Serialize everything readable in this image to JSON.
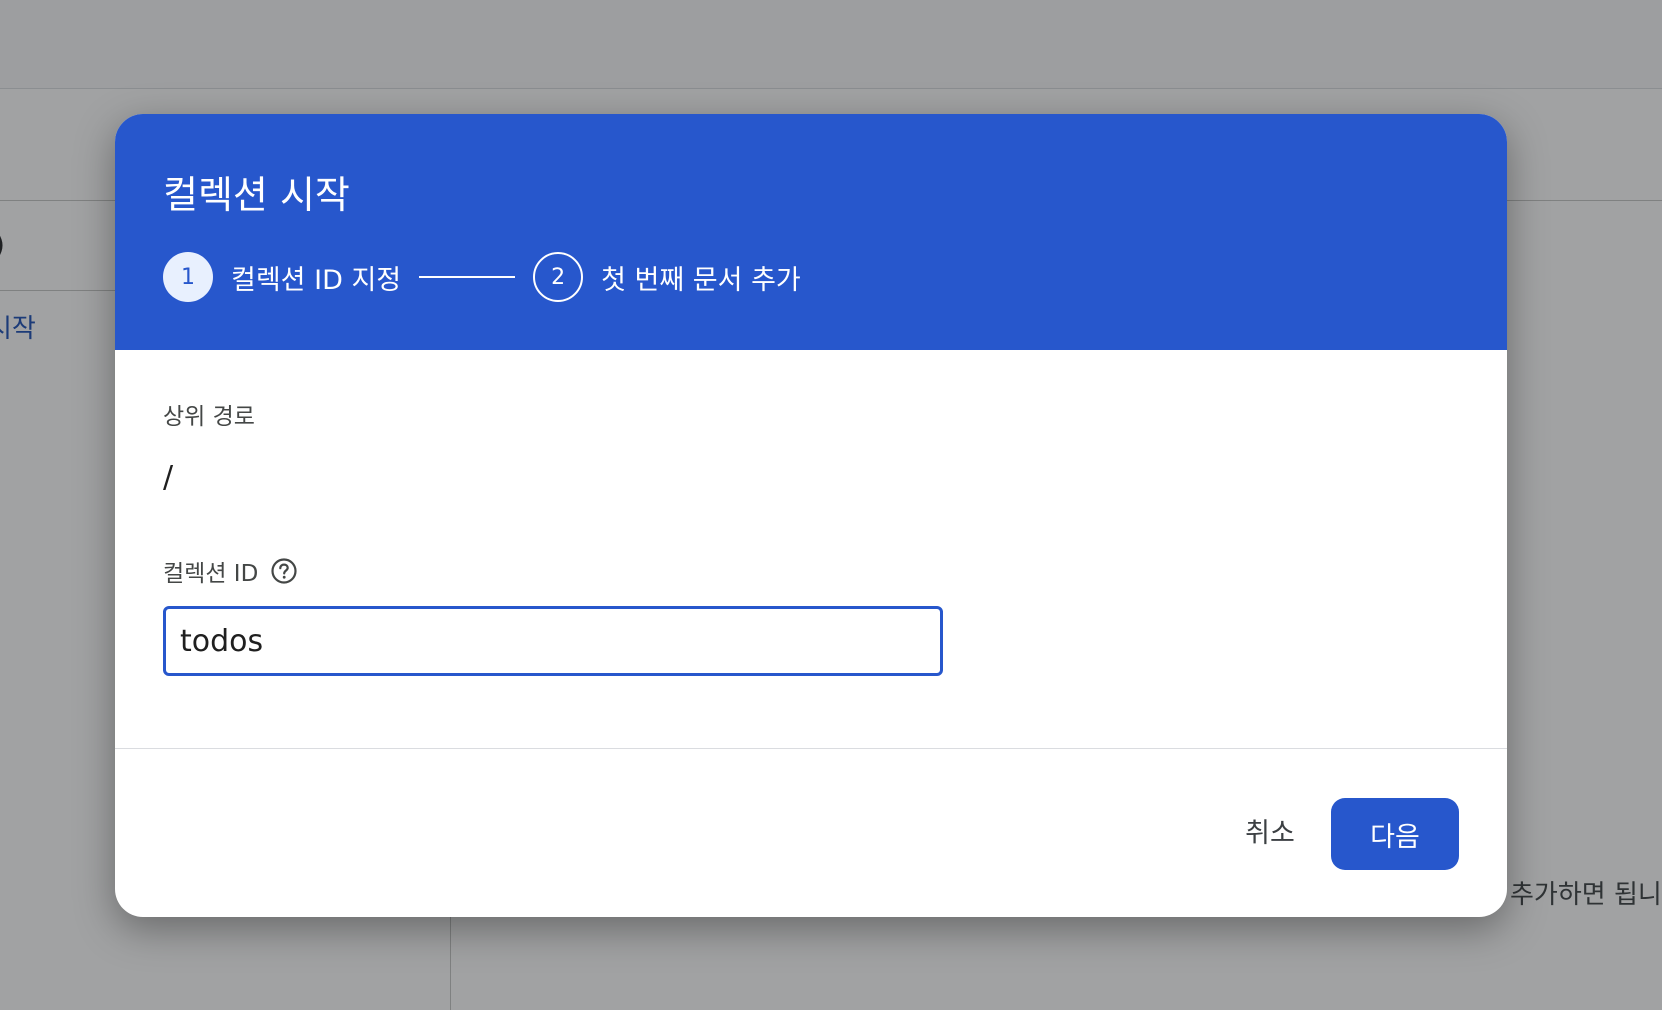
{
  "background": {
    "left_fragment_paren": ")",
    "left_fragment_text": "시작",
    "right_fragment_text": "추가하면 됩니"
  },
  "dialog": {
    "title": "컬렉션 시작",
    "steps": [
      {
        "number": "1",
        "label": "컬렉션 ID 지정",
        "state": "active"
      },
      {
        "number": "2",
        "label": "첫 번째 문서 추가",
        "state": "inactive"
      }
    ],
    "parent_path": {
      "label": "상위 경로",
      "value": "/"
    },
    "collection_id": {
      "label": "컬렉션 ID",
      "value": "todos",
      "help_icon": "help-circle-icon"
    },
    "actions": {
      "cancel_label": "취소",
      "next_label": "다음"
    }
  },
  "colors": {
    "header_blue": "#2757cc",
    "primary_button": "#2757cc",
    "input_border_focus": "#2757cc"
  }
}
